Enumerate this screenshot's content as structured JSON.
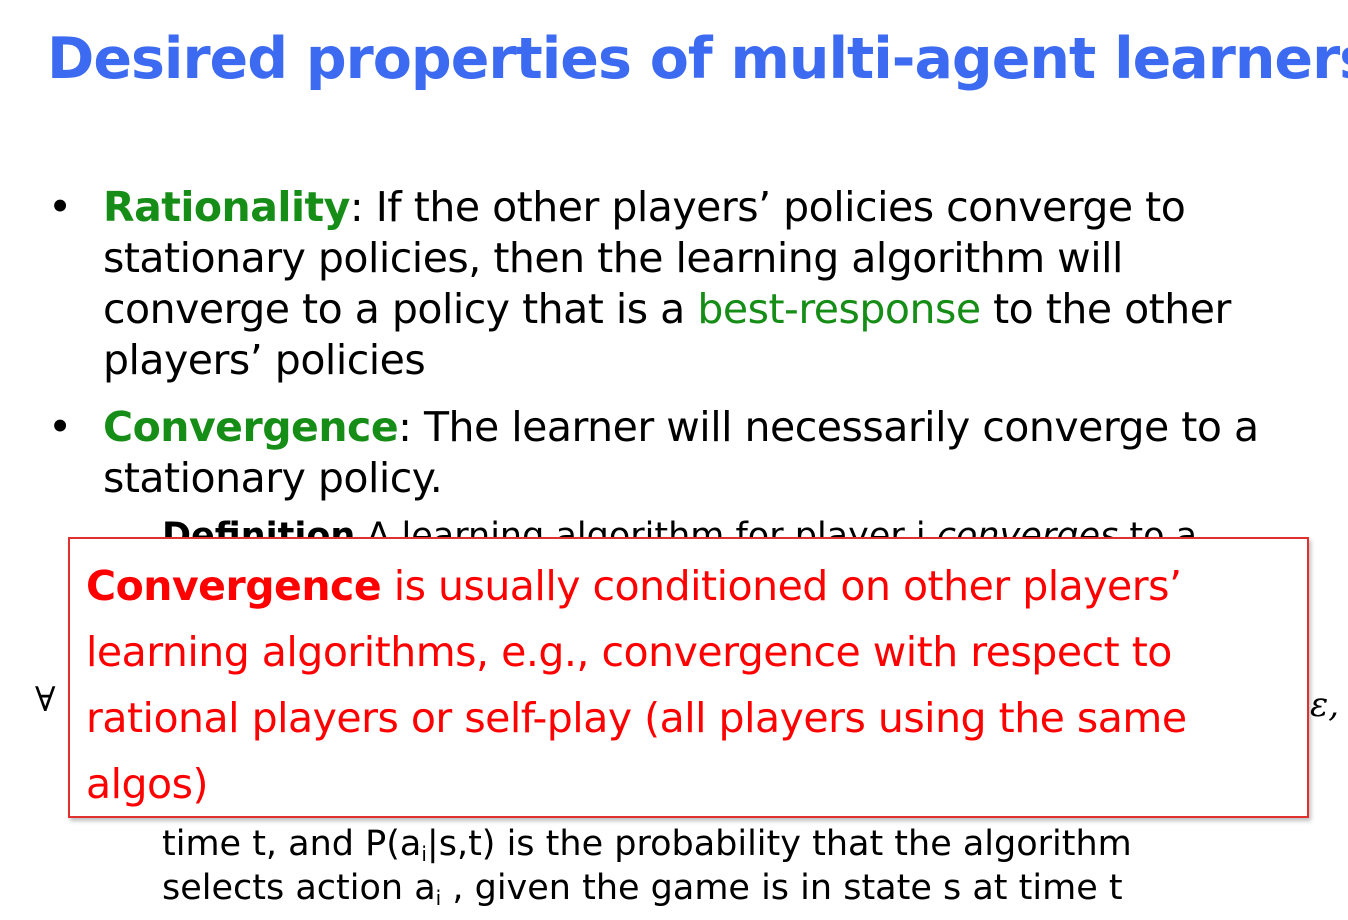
{
  "title": "Desired properties of multi-agent learners",
  "colors": {
    "title": "#3c6af0",
    "accent_green": "#168d16",
    "callout_red": "#ff0000",
    "callout_border": "#e03030"
  },
  "bullets": [
    {
      "marker": "•",
      "term": "Rationality",
      "after_term": ":  If the other players’ policies converge to stationary policies, then the learning algorithm will converge to a policy that is a ",
      "highlight": "best-response",
      "end": " to the other players’ policies"
    },
    {
      "marker": "•",
      "term": "Convergence",
      "after_term": ": The learner will necessarily converge to a stationary policy."
    }
  ],
  "definition": {
    "bold": "Definition",
    "text": " A learning algorithm for player i ",
    "italic": "converges",
    "tail": " to a"
  },
  "math": {
    "forall": "∀",
    "epsilon": "ε,"
  },
  "lower_text": {
    "line2_a": "time t, and P(a",
    "line2_sub": "i",
    "line2_b": "|s,t) is the probability that the algorithm",
    "line3_a": "selects action a",
    "line3_sub": "i",
    "line3_b": " , given the game is in state s at time t"
  },
  "callout": {
    "bold": "Convergence",
    "text": " is usually conditioned on other players’ learning algorithms, e.g., convergence with respect to rational players or self-play (all players using the same algos)"
  }
}
